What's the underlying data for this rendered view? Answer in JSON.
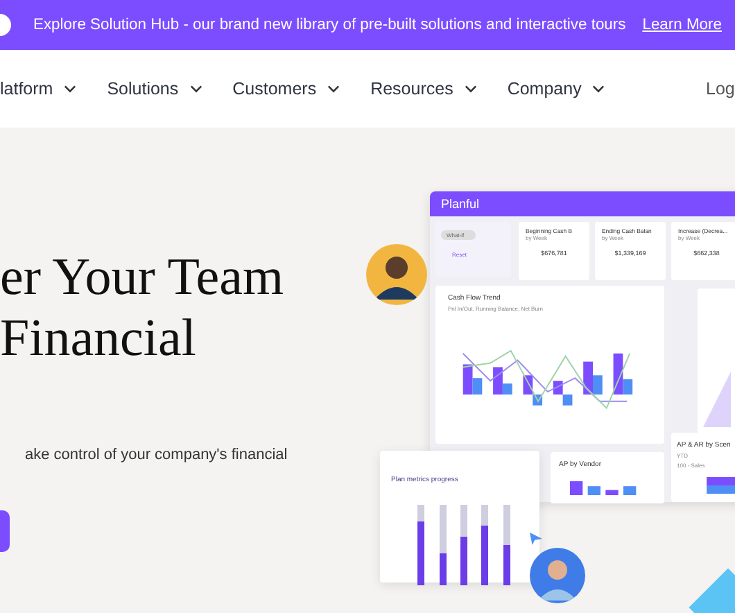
{
  "banner": {
    "text": "Explore Solution Hub - our brand new library of pre-built solutions and interactive tours",
    "link": "Learn More"
  },
  "nav": {
    "items": [
      "latform",
      "Solutions",
      "Customers",
      "Resources",
      "Company"
    ],
    "login": "Log"
  },
  "hero": {
    "heading_lines": [
      "er Your Team",
      "Financial"
    ],
    "paragraph": "ake control of your company's financial"
  },
  "dashboard": {
    "title": "Planful",
    "filter": {
      "select": "What-if",
      "reset": "Reset"
    },
    "kpis": [
      {
        "title": "Beginning Cash B",
        "subtitle": "by Week",
        "value": "$676,781"
      },
      {
        "title": "Ending Cash Balan",
        "subtitle": "by Week",
        "value": "$1,339,169"
      },
      {
        "title": "Increase (Decrea...",
        "subtitle": "by Week",
        "value": "$662,338"
      }
    ],
    "cash_flow": {
      "title": "Cash Flow Trend",
      "subtitle": "Pnl In/Out, Running Balance, Net Burn"
    },
    "ap_vendor": {
      "title": "AP by Vendor"
    },
    "ap_ar": {
      "title": "AP & AR by Scen",
      "subtitle": "YTD",
      "legend": "100 - Sales"
    },
    "plan_metrics": {
      "title": "Plan metrics progress",
      "bars": [
        {
          "level": 0.8
        },
        {
          "level": 0.4
        },
        {
          "level": 0.6
        },
        {
          "level": 0.75
        },
        {
          "level": 0.5
        }
      ]
    }
  }
}
